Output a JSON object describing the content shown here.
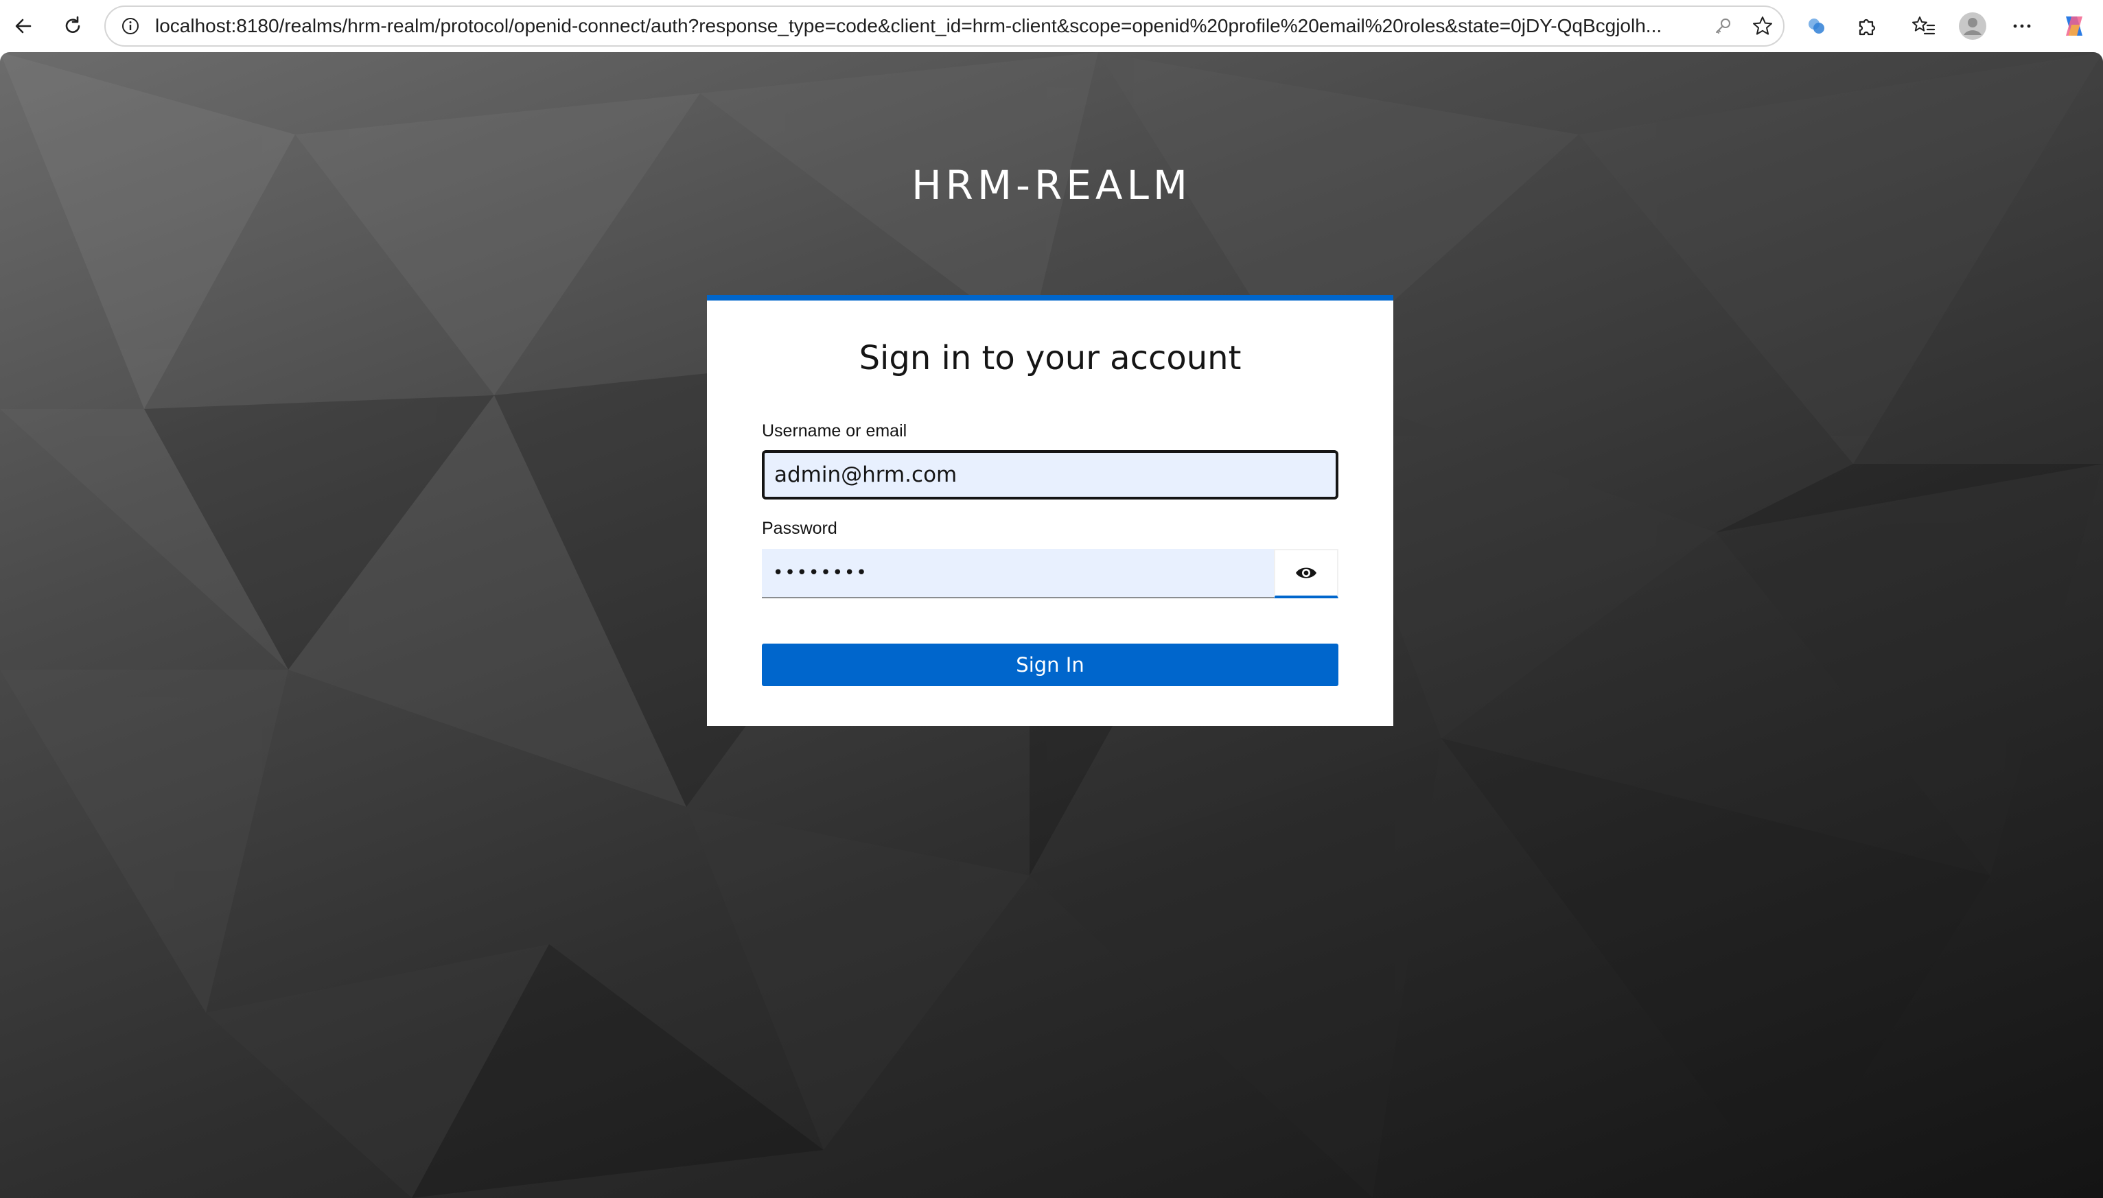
{
  "browser": {
    "url": "localhost:8180/realms/hrm-realm/protocol/openid-connect/auth?response_type=code&client_id=hrm-client&scope=openid%20profile%20email%20roles&state=0jDY-QqBcgjolh...",
    "icons": [
      "back-arrow-icon",
      "reload-icon",
      "site-info-icon",
      "key-icon",
      "star-icon",
      "extension-profile-icon",
      "puzzle-icon",
      "favorites-icon",
      "profile-avatar-icon",
      "more-icon",
      "copilot-icon"
    ]
  },
  "page": {
    "realm_title": "HRM-REALM",
    "accent_color": "#0066cc"
  },
  "login": {
    "heading": "Sign in to your account",
    "username_label": "Username or email",
    "username_value": "admin@hrm.com",
    "password_label": "Password",
    "password_value": "••••••••",
    "show_password_icon": "eye-icon",
    "submit_label": "Sign In"
  }
}
